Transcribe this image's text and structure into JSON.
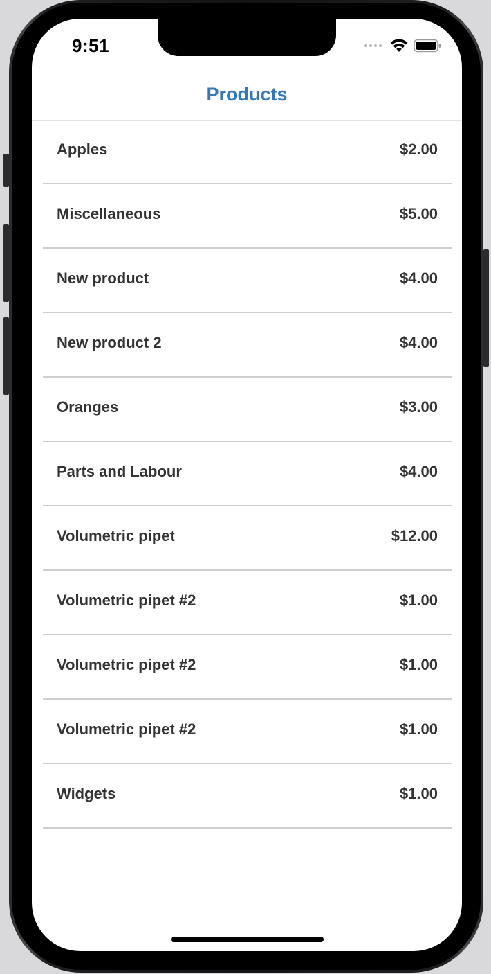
{
  "status_bar": {
    "time": "9:51",
    "icons": [
      "signal-dots-icon",
      "wifi-icon",
      "battery-icon"
    ]
  },
  "nav": {
    "title": "Products"
  },
  "colors": {
    "accent": "#3478b8",
    "text": "#333333",
    "separator": "#cfcfd1"
  },
  "products": [
    {
      "name": "Apples",
      "price": "$2.00"
    },
    {
      "name": "Miscellaneous",
      "price": "$5.00"
    },
    {
      "name": "New product",
      "price": "$4.00"
    },
    {
      "name": "New product 2",
      "price": "$4.00"
    },
    {
      "name": "Oranges",
      "price": "$3.00"
    },
    {
      "name": "Parts and Labour",
      "price": "$4.00"
    },
    {
      "name": "Volumetric pipet",
      "price": "$12.00"
    },
    {
      "name": "Volumetric pipet #2",
      "price": "$1.00"
    },
    {
      "name": "Volumetric pipet #2",
      "price": "$1.00"
    },
    {
      "name": "Volumetric pipet #2",
      "price": "$1.00"
    },
    {
      "name": "Widgets",
      "price": "$1.00"
    }
  ]
}
